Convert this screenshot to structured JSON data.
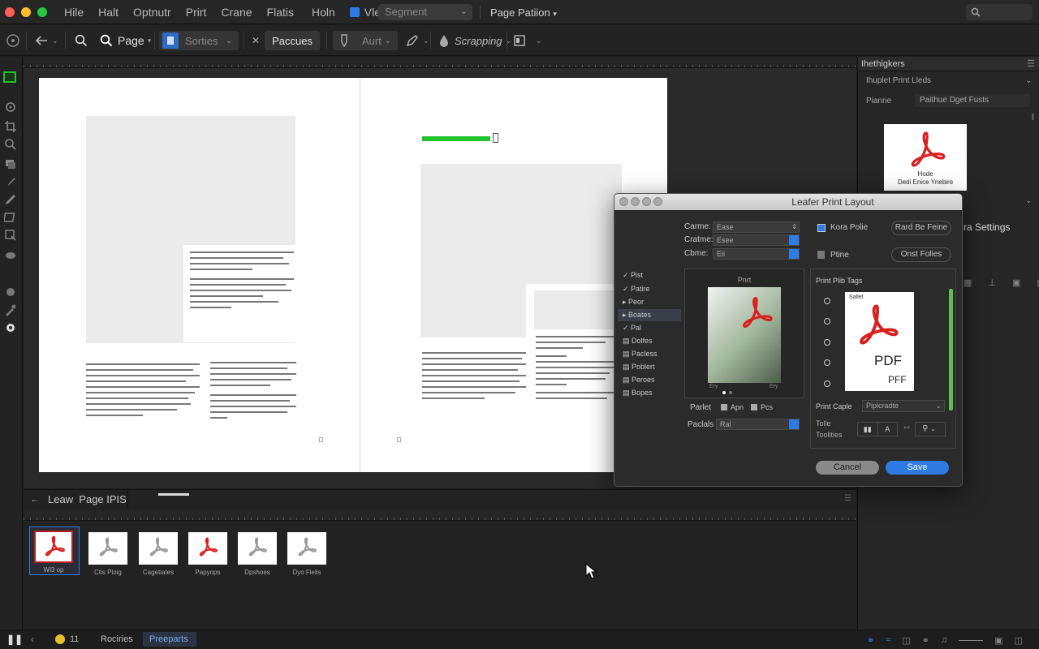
{
  "menubar": {
    "items": [
      "Hile",
      "Halt",
      "Optnutr",
      "Prirt",
      "Crane",
      "Flatis",
      "Holn",
      "Vledy"
    ],
    "segment_select": "Segment",
    "page_pattern": "Page Patiion"
  },
  "toolbar": {
    "page_label": "Page",
    "sorties_label": "Sorties",
    "paccues_label": "Paccues",
    "auto_label": "Aurt",
    "scrapping_label": "Scrapping"
  },
  "right_panel": {
    "header": "Ihethigkers",
    "dropdown": "Ihuplet Print Lleds",
    "name_label": "Pianne",
    "name_value": "Paithue Dget Fusts",
    "preview_caption_1": "Hode",
    "preview_caption_2": "Dedi Enice Ynebire",
    "settings_label": "ra Settings"
  },
  "dialog": {
    "title": "Leafer Print Layout",
    "fields": [
      {
        "label": "Carme:",
        "value": "Ease"
      },
      {
        "label": "Cratme:",
        "value": "Esee"
      },
      {
        "label": "Cbme:",
        "value": "Eii"
      }
    ],
    "list": [
      "Pist",
      "Patire",
      "Peor",
      "Boates",
      "Pal",
      "Dolfes",
      "Pacless",
      "Poblert",
      "Peroes",
      "Bopes"
    ],
    "preview_title": "Pnrt",
    "preview_left": "Ery",
    "preview_right": "Ery",
    "right_buttons": [
      "Kora Polie",
      "Rard Be Feine",
      "Ptine",
      "Onst Folies"
    ],
    "tags_title": "Print Plib Tags",
    "pdf_label": "PDF",
    "pdf_subtitle": "PFF",
    "pdf_corner": "Sallet",
    "parlet_label": "Parlet",
    "check_1": "Apn",
    "check_2": "Pcs",
    "paclals_label": "Paclals",
    "paclals_value": "Rai",
    "print_caple_label": "Print Caple",
    "print_caple_value": "Pipicradte",
    "toolbar_label_1": "Tolle",
    "toolbar_label_2": "Toolities",
    "cancel_label": "Cancel",
    "save_label": "Save"
  },
  "bottom_panel": {
    "title": "Leaw  Page IPIS",
    "thumbnails": [
      "Wi3 op",
      "Ctis Ploig",
      "Cagetiates",
      "Papyops",
      "Dpshoes",
      "Dyo Flelis"
    ]
  },
  "statusbar": {
    "count": "11",
    "tab_1": "Rociries",
    "tab_2": "Preeparts"
  },
  "colors": {
    "accent_blue": "#2e7be6",
    "green_bar": "#22c22c",
    "pdf_red": "#d91f1f",
    "highlight_green": "#5cbf4f"
  }
}
